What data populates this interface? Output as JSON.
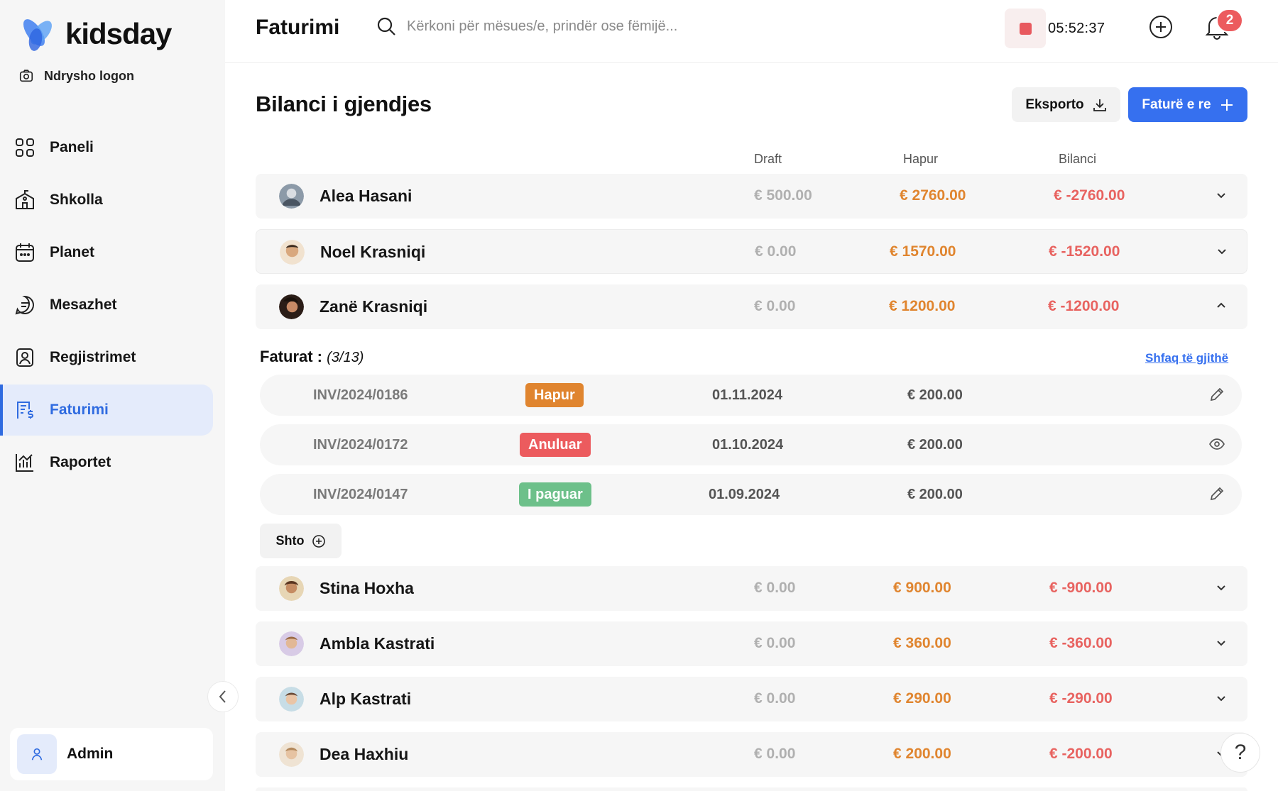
{
  "sidebar": {
    "brand": "kidsday",
    "change_logo": "Ndrysho logon",
    "items": [
      {
        "label": "Paneli"
      },
      {
        "label": "Shkolla"
      },
      {
        "label": "Planet"
      },
      {
        "label": "Mesazhet"
      },
      {
        "label": "Regjistrimet"
      },
      {
        "label": "Faturimi",
        "active": true
      },
      {
        "label": "Raportet"
      }
    ],
    "user": "Admin"
  },
  "header": {
    "title": "Faturimi",
    "search_placeholder": "Kërkoni për mësues/e, prindër ose fëmijë...",
    "timer": "05:52:37",
    "notifications": "2"
  },
  "main": {
    "title": "Bilanci i gjendjes",
    "export_label": "Eksporto",
    "new_invoice_label": "Faturë e re",
    "columns": {
      "draft": "Draft",
      "open": "Hapur",
      "balance": "Bilanci"
    },
    "rows": [
      {
        "name": "Alea Hasani",
        "draft": "€ 500.00",
        "open": "€ 2760.00",
        "balance": "€ -2760.00"
      },
      {
        "name": "Noel Krasniqi",
        "draft": "€ 0.00",
        "open": "€ 1570.00",
        "balance": "€ -1520.00"
      },
      {
        "name": "Zanë Krasniqi",
        "draft": "€ 0.00",
        "open": "€ 1200.00",
        "balance": "€ -1200.00"
      },
      {
        "name": "Stina Hoxha",
        "draft": "€ 0.00",
        "open": "€ 900.00",
        "balance": "€ -900.00"
      },
      {
        "name": "Ambla Kastrati",
        "draft": "€ 0.00",
        "open": "€ 360.00",
        "balance": "€ -360.00"
      },
      {
        "name": "Alp Kastrati",
        "draft": "€ 0.00",
        "open": "€ 290.00",
        "balance": "€ -290.00"
      },
      {
        "name": "Dea Haxhiu",
        "draft": "€ 0.00",
        "open": "€ 200.00",
        "balance": "€ -200.00"
      }
    ],
    "invoices": {
      "label": "Faturat :",
      "count": "(3/13)",
      "show_all": "Shfaq të gjithë",
      "items": [
        {
          "number": "INV/2024/0186",
          "status": "Hapur",
          "date": "01.11.2024",
          "amount": "€ 200.00"
        },
        {
          "number": "INV/2024/0172",
          "status": "Anuluar",
          "date": "01.10.2024",
          "amount": "€ 200.00"
        },
        {
          "number": "INV/2024/0147",
          "status": "I paguar",
          "date": "01.09.2024",
          "amount": "€ 200.00"
        }
      ],
      "add_label": "Shto"
    },
    "help": "?"
  },
  "colors": {
    "accent": "#3670ef",
    "open_amount": "#e0852f",
    "balance_amount": "#e86360",
    "status_open": "#e0852f",
    "status_cancelled": "#ec5b5e",
    "status_paid": "#6dc08a"
  }
}
